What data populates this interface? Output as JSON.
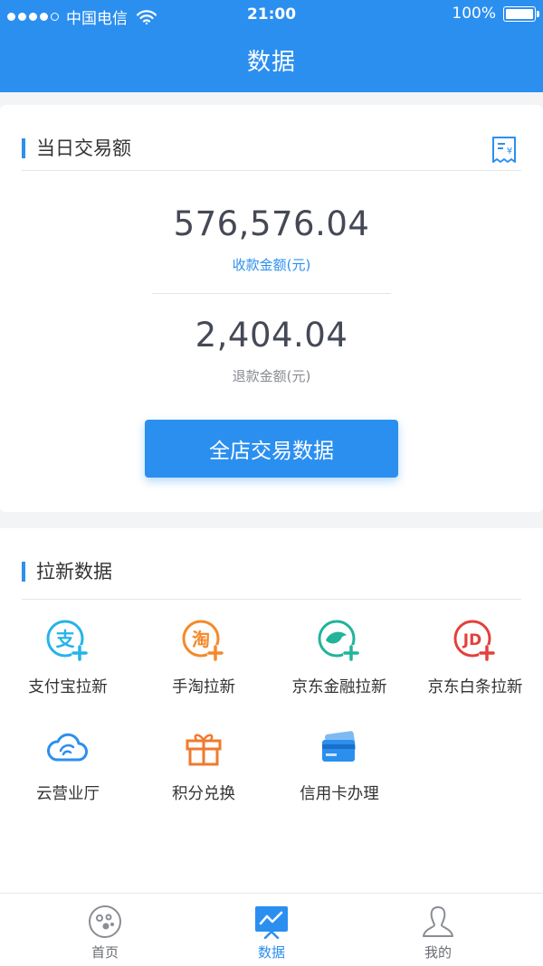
{
  "status_bar": {
    "carrier": "中国电信",
    "time": "21:00",
    "battery": "100%"
  },
  "header": {
    "title": "数据"
  },
  "daily": {
    "title": "当日交易额",
    "receipt_amount": "576,576.04",
    "receipt_label": "收款金额(元)",
    "refund_amount": "2,404.04",
    "refund_label": "退款金额(元)",
    "button_label": "全店交易数据"
  },
  "acquisition": {
    "title": "拉新数据",
    "items": [
      {
        "label": "支付宝拉新",
        "icon": "alipay-acquire-icon",
        "color": "#27b3e9"
      },
      {
        "label": "手淘拉新",
        "icon": "taobao-acquire-icon",
        "color": "#f5892a"
      },
      {
        "label": "京东金融拉新",
        "icon": "jd-finance-acquire-icon",
        "color": "#21b49a"
      },
      {
        "label": "京东白条拉新",
        "icon": "jd-baitiao-acquire-icon",
        "color": "#e2413c"
      },
      {
        "label": "云营业厅",
        "icon": "cloud-hall-icon",
        "color": "#2b8ff0"
      },
      {
        "label": "积分兑换",
        "icon": "gift-points-icon",
        "color": "#f07a2e"
      },
      {
        "label": "信用卡办理",
        "icon": "credit-card-icon",
        "color": "#2b8ff0"
      }
    ]
  },
  "tabbar": {
    "items": [
      {
        "label": "首页",
        "icon": "home-icon",
        "active": false
      },
      {
        "label": "数据",
        "icon": "chart-icon",
        "active": true
      },
      {
        "label": "我的",
        "icon": "profile-icon",
        "active": false
      }
    ]
  },
  "colors": {
    "primary": "#2b8ff0",
    "text_dark": "#454856",
    "text_muted": "#888a92"
  }
}
